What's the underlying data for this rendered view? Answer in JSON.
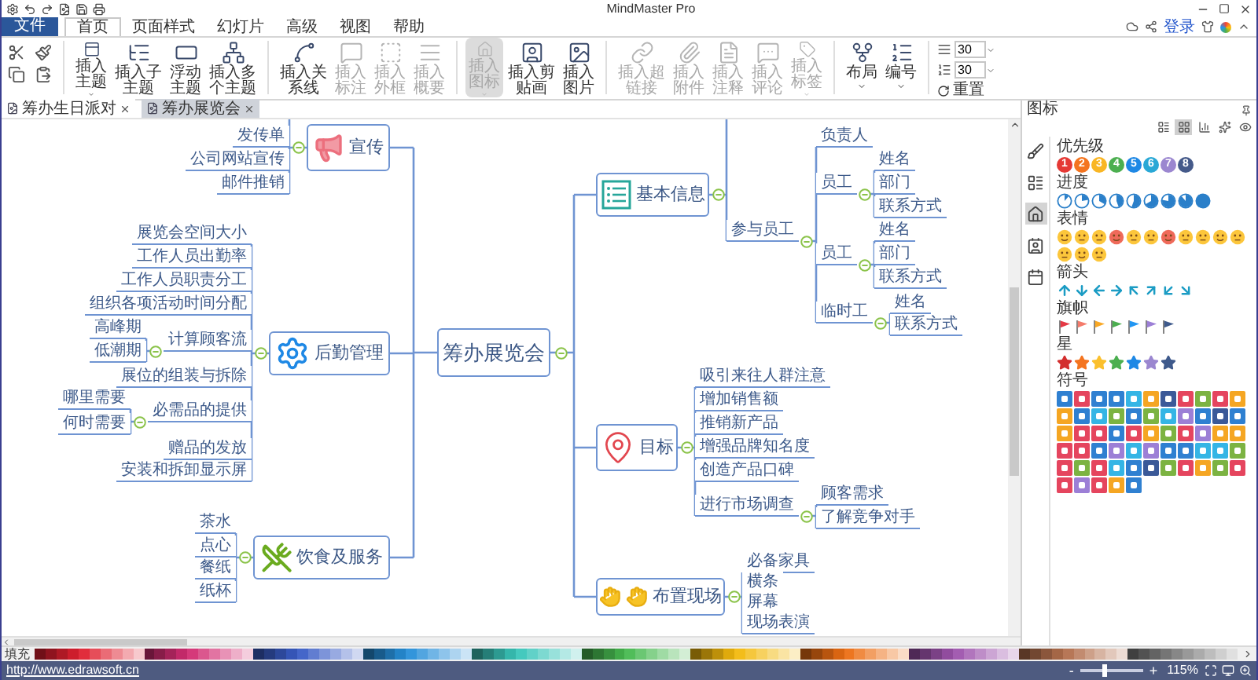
{
  "window": {
    "title": "MindMaster Pro"
  },
  "menu": {
    "file": "文件",
    "tabs": [
      {
        "label": "首页",
        "selected": true
      },
      {
        "label": "页面样式",
        "selected": false
      },
      {
        "label": "幻灯片",
        "selected": false
      },
      {
        "label": "高级",
        "selected": false
      },
      {
        "label": "视图",
        "selected": false
      },
      {
        "label": "帮助",
        "selected": false
      }
    ],
    "login": "登录"
  },
  "ribbon": {
    "groups": [
      {
        "buttons": [
          {
            "label": "插入主题",
            "disabled": false,
            "pressed": false,
            "menu": true
          },
          {
            "label": "插入子主题",
            "disabled": false,
            "pressed": false,
            "menu": false
          },
          {
            "label": "浮动主题",
            "disabled": false,
            "pressed": false,
            "menu": false
          },
          {
            "label": "插入多个主题",
            "disabled": false,
            "pressed": false,
            "menu": false
          }
        ]
      },
      {
        "buttons": [
          {
            "label": "插入关系线",
            "disabled": false,
            "pressed": false,
            "menu": false
          },
          {
            "label": "插入标注",
            "disabled": true,
            "pressed": false,
            "menu": false
          },
          {
            "label": "插入外框",
            "disabled": true,
            "pressed": false,
            "menu": false
          },
          {
            "label": "插入概要",
            "disabled": true,
            "pressed": false,
            "menu": false
          }
        ]
      },
      {
        "buttons": [
          {
            "label": "插入图标",
            "disabled": true,
            "pressed": true,
            "menu": true
          },
          {
            "label": "插入剪贴画",
            "disabled": false,
            "pressed": false,
            "menu": false
          },
          {
            "label": "插入图片",
            "disabled": false,
            "pressed": false,
            "menu": false
          }
        ]
      },
      {
        "buttons": [
          {
            "label": "插入超链接",
            "disabled": true,
            "pressed": false,
            "menu": false
          },
          {
            "label": "插入附件",
            "disabled": true,
            "pressed": false,
            "menu": false
          },
          {
            "label": "插入注释",
            "disabled": true,
            "pressed": false,
            "menu": false
          },
          {
            "label": "插入评论",
            "disabled": true,
            "pressed": false,
            "menu": false
          },
          {
            "label": "插入标签",
            "disabled": true,
            "pressed": false,
            "menu": true
          }
        ]
      },
      {
        "buttons": [
          {
            "label": "布局",
            "disabled": false,
            "pressed": false,
            "menu": true
          },
          {
            "label": "编号",
            "disabled": false,
            "pressed": false,
            "menu": true
          }
        ]
      }
    ],
    "spacing": [
      {
        "value": "30"
      },
      {
        "value": "30"
      }
    ],
    "reset": "重置"
  },
  "doc_tabs": [
    {
      "label": "筹办生日派对",
      "selected": false
    },
    {
      "label": "筹办展览会",
      "selected": true
    }
  ],
  "mindmap": {
    "central": "筹办展览会",
    "left": [
      {
        "title": "宣传",
        "children": [
          {
            "text": "发传单"
          },
          {
            "text": "公司网站宣传"
          },
          {
            "text": "邮件推销"
          }
        ]
      },
      {
        "title": "后勤管理",
        "children": [
          {
            "text": "展览会空间大小"
          },
          {
            "text": "工作人员出勤率"
          },
          {
            "text": "工作人员职责分工"
          },
          {
            "text": "组织各项活动时间分配"
          },
          {
            "text": "计算顾客流",
            "children": [
              {
                "text": "高峰期"
              },
              {
                "text": "低潮期"
              }
            ]
          },
          {
            "text": "展位的组装与拆除"
          },
          {
            "text": "必需品的提供",
            "children": [
              {
                "text": "哪里需要"
              },
              {
                "text": "何时需要"
              }
            ]
          },
          {
            "text": "赠品的发放"
          },
          {
            "text": "安装和拆卸显示屏"
          }
        ]
      },
      {
        "title": "饮食及服务",
        "children": [
          {
            "text": "茶水"
          },
          {
            "text": "点心"
          },
          {
            "text": "餐纸"
          },
          {
            "text": "纸杯"
          }
        ]
      }
    ],
    "right": [
      {
        "title": "基本信息",
        "children": [
          {
            "text": "参与员工",
            "children": [
              {
                "text": "负责人"
              },
              {
                "text": "员工",
                "children": [
                  {
                    "text": "姓名"
                  },
                  {
                    "text": "部门"
                  },
                  {
                    "text": "联系方式"
                  }
                ]
              },
              {
                "text": "员工",
                "children": [
                  {
                    "text": "姓名"
                  },
                  {
                    "text": "部门"
                  },
                  {
                    "text": "联系方式"
                  }
                ]
              },
              {
                "text": "临时工",
                "children": [
                  {
                    "text": "姓名"
                  },
                  {
                    "text": "联系方式"
                  }
                ]
              }
            ]
          }
        ]
      },
      {
        "title": "目标",
        "children": [
          {
            "text": "吸引来往人群注意"
          },
          {
            "text": "增加销售额"
          },
          {
            "text": "推销新产品"
          },
          {
            "text": "增强品牌知名度"
          },
          {
            "text": "创造产品口碑"
          },
          {
            "text": "进行市场调查",
            "children": [
              {
                "text": "顾客需求"
              },
              {
                "text": "了解竞争对手"
              }
            ]
          }
        ]
      },
      {
        "title": "布置现场",
        "children": [
          {
            "text": "必备家具"
          },
          {
            "text": "横条"
          },
          {
            "text": "屏幕"
          },
          {
            "text": "现场表演"
          }
        ]
      }
    ]
  },
  "panel": {
    "title": "图标",
    "views": [
      {
        "selected": false
      },
      {
        "selected": true
      },
      {
        "selected": false
      },
      {
        "selected": false
      },
      {
        "selected": false
      }
    ],
    "side_tabs": [
      {
        "selected": false
      },
      {
        "selected": false
      },
      {
        "selected": true
      },
      {
        "selected": false
      },
      {
        "selected": false
      }
    ],
    "sections": [
      {
        "kind": "priority",
        "title": "优先级",
        "items": [
          {
            "label": "1",
            "color": "#e53935"
          },
          {
            "label": "2",
            "color": "#f4741f"
          },
          {
            "label": "3",
            "color": "#f9b625"
          },
          {
            "label": "4",
            "color": "#4caf50"
          },
          {
            "label": "5",
            "color": "#1e88e5"
          },
          {
            "label": "6",
            "color": "#29a8d6"
          },
          {
            "label": "7",
            "color": "#9b87d0"
          },
          {
            "label": "8",
            "color": "#455a8a"
          }
        ]
      },
      {
        "kind": "progress",
        "title": "进度"
      },
      {
        "kind": "emoji",
        "title": "表情"
      },
      {
        "kind": "arrow",
        "title": "箭头"
      },
      {
        "kind": "flag",
        "title": "旗帜",
        "items": [
          {
            "color": "#e53945"
          },
          {
            "color": "#f47b6b"
          },
          {
            "color": "#f9a825"
          },
          {
            "color": "#4caf50"
          },
          {
            "color": "#2196f3"
          },
          {
            "color": "#9c7fd6"
          },
          {
            "color": "#3f5a8c"
          }
        ]
      },
      {
        "kind": "star",
        "title": "星",
        "items": [
          {
            "color": "#d32f2f"
          },
          {
            "color": "#f4741f"
          },
          {
            "color": "#fbc02d"
          },
          {
            "color": "#4caf50"
          },
          {
            "color": "#1e88e5"
          },
          {
            "color": "#9b87d0"
          },
          {
            "color": "#3f5a8c"
          }
        ]
      },
      {
        "kind": "symbol",
        "title": "符号"
      }
    ]
  },
  "palette": {
    "label": "填充"
  },
  "status_bar": {
    "link": "http://www.edrawsoft.cn",
    "zoom_out": "-",
    "zoom": {
      "level": 0.4
    },
    "zoom_in": "+",
    "reading": "115%"
  }
}
